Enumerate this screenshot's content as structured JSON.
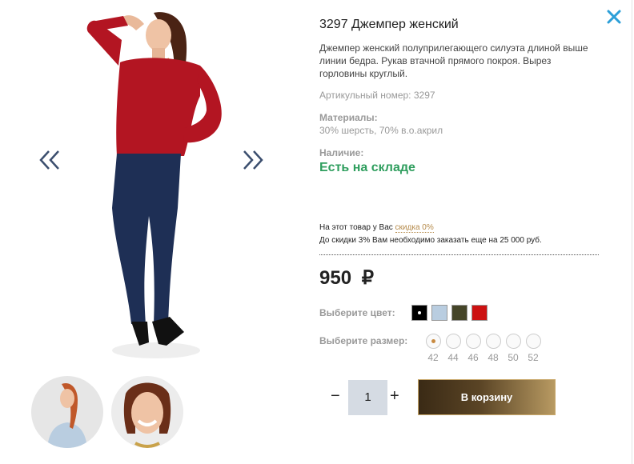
{
  "product": {
    "title": "3297 Джемпер женский",
    "description": "Джемпер женский полуприлегающего силуэта длиной выше линии бедра. Рукав втачной прямого покроя. Вырез горловины круглый.",
    "sku": "Артикульный номер: 3297",
    "materials_label": "Материалы:",
    "materials_value": "30% шерсть, 70% в.о.акрил",
    "availability_label": "Наличие:",
    "availability_value": "Есть на складе"
  },
  "discount": {
    "line1_prefix": "На этот товар у Вас",
    "line1_link": "скидка 0%",
    "line2": "До скидки 3% Вам необходимо заказать еще на 25 000 руб."
  },
  "price": {
    "amount": "950",
    "currency": "₽"
  },
  "colors": {
    "label": "Выберите цвет:",
    "swatches": [
      "#000000",
      "#b9cde0",
      "#454528",
      "#cc1111"
    ],
    "selected_index": 0
  },
  "sizes": {
    "label": "Выберите размер:",
    "options": [
      "42",
      "44",
      "46",
      "48",
      "50",
      "52"
    ],
    "selected_index": 0
  },
  "cart": {
    "minus": "−",
    "plus": "+",
    "quantity": "1",
    "button": "В корзину"
  },
  "icons": {
    "close": "close-icon",
    "prev": "double-chevron-left-icon",
    "next": "double-chevron-right-icon"
  },
  "accent_color": "#2f9e5e"
}
